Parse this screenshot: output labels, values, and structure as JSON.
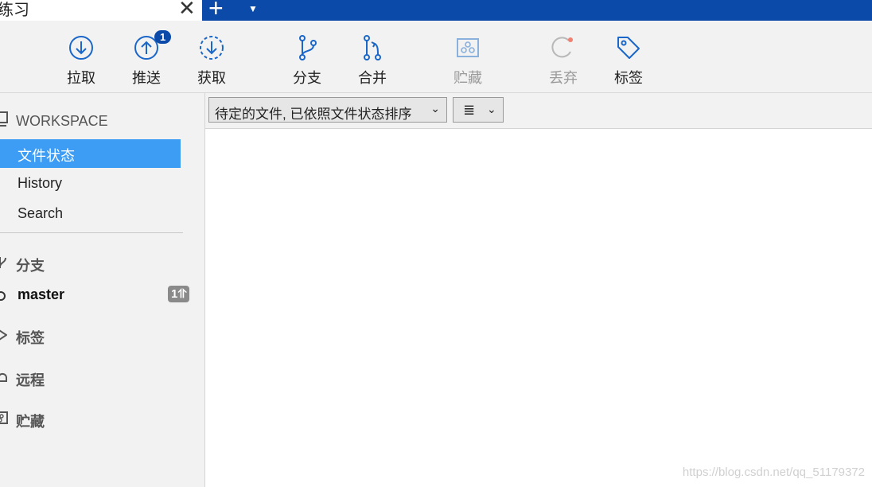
{
  "tab": {
    "title": "练习",
    "close_glyph": "✕",
    "add_glyph": "+",
    "menu_glyph": "▼"
  },
  "toolbar": {
    "pull": "拉取",
    "push": "推送",
    "push_badge": "1",
    "fetch": "获取",
    "branch": "分支",
    "merge": "合并",
    "stash": "贮藏",
    "discard": "丢弃",
    "tag": "标签"
  },
  "sidebar": {
    "workspace": "WORKSPACE",
    "nav": [
      "文件状态",
      "History",
      "Search"
    ],
    "branches_header": "分支",
    "branch": {
      "name": "master",
      "ahead": "1⥣"
    },
    "tags_header": "标签",
    "remotes_header": "远程",
    "stashes_header": "贮藏"
  },
  "filter": {
    "sort_option": "待定的文件, 已依照文件状态排序",
    "view_icon": "≣",
    "chevron": "⌄"
  },
  "watermark": "https://blog.csdn.net/qq_51179372",
  "colors": {
    "accent": "#0b4aa8",
    "selection": "#3d9df5",
    "icon_blue": "#1a66c9"
  }
}
